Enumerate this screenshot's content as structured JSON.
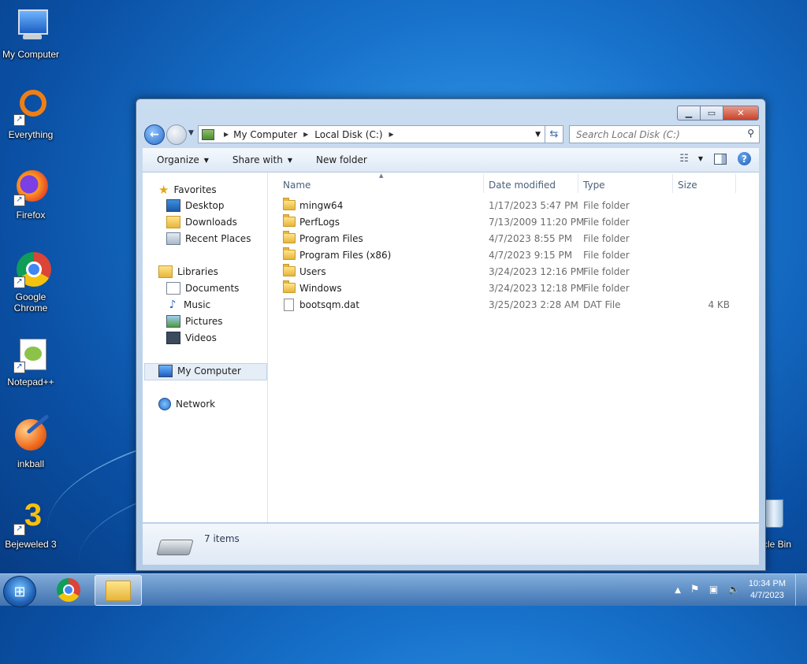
{
  "desktop": {
    "icons": [
      {
        "label": "My Computer"
      },
      {
        "label": "Everything"
      },
      {
        "label": "Firefox"
      },
      {
        "label": "Google Chrome"
      },
      {
        "label": "Notepad++"
      },
      {
        "label": "inkball"
      },
      {
        "label": "Bejeweled 3"
      },
      {
        "label": "cle Bin"
      }
    ]
  },
  "window": {
    "address": {
      "crumbs": [
        "My Computer",
        "Local Disk (C:)"
      ]
    },
    "search": {
      "placeholder": "Search Local Disk (C:)"
    },
    "toolbar": {
      "organize": "Organize",
      "share_with": "Share with",
      "new_folder": "New folder"
    },
    "nav": {
      "favorites": "Favorites",
      "desktop": "Desktop",
      "downloads": "Downloads",
      "recent_places": "Recent Places",
      "libraries": "Libraries",
      "documents": "Documents",
      "music": "Music",
      "pictures": "Pictures",
      "videos": "Videos",
      "my_computer": "My Computer",
      "network": "Network"
    },
    "columns": {
      "name": "Name",
      "date": "Date modified",
      "type": "Type",
      "size": "Size"
    },
    "files": [
      {
        "name": "mingw64",
        "date": "1/17/2023 5:47 PM",
        "type": "File folder",
        "size": "",
        "kind": "folder"
      },
      {
        "name": "PerfLogs",
        "date": "7/13/2009 11:20 PM",
        "type": "File folder",
        "size": "",
        "kind": "folder"
      },
      {
        "name": "Program Files",
        "date": "4/7/2023 8:55 PM",
        "type": "File folder",
        "size": "",
        "kind": "folder"
      },
      {
        "name": "Program Files (x86)",
        "date": "4/7/2023 9:15 PM",
        "type": "File folder",
        "size": "",
        "kind": "folder"
      },
      {
        "name": "Users",
        "date": "3/24/2023 12:16 PM",
        "type": "File folder",
        "size": "",
        "kind": "folder"
      },
      {
        "name": "Windows",
        "date": "3/24/2023 12:18 PM",
        "type": "File folder",
        "size": "",
        "kind": "folder"
      },
      {
        "name": "bootsqm.dat",
        "date": "3/25/2023 2:28 AM",
        "type": "DAT File",
        "size": "4 KB",
        "kind": "file"
      }
    ],
    "status": {
      "item_count": "7 items"
    }
  },
  "taskbar": {
    "clock": {
      "time": "10:34 PM",
      "date": "4/7/2023"
    }
  },
  "colors": {
    "accent": "#1f62b8",
    "selection": "#e5edf7"
  }
}
